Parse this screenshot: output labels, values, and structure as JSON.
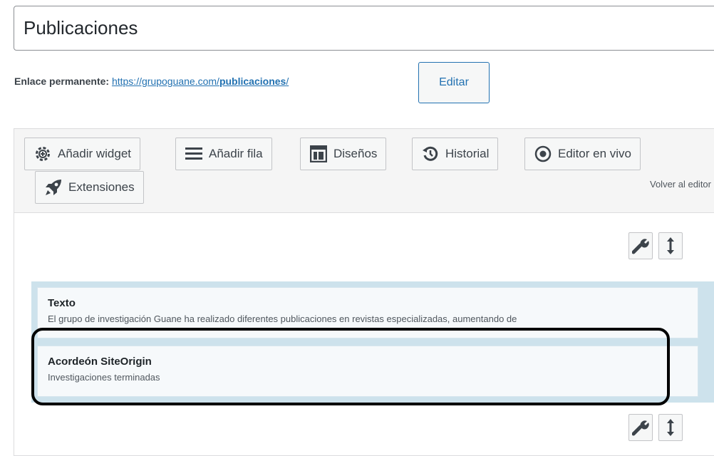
{
  "post": {
    "title": "Publicaciones",
    "permalink_label": "Enlace permanente:",
    "permalink_base": "https://grupoguane.com/",
    "permalink_slug": "publicaciones",
    "permalink_trail": "/",
    "edit_label": "Editar"
  },
  "builder": {
    "toolbar": {
      "add_widget": "Añadir widget",
      "add_row": "Añadir fila",
      "layouts": "Diseños",
      "history": "Historial",
      "live_editor": "Editor en vivo",
      "extensions": "Extensiones",
      "back_to_editor": "Volver al editor"
    },
    "widgets": [
      {
        "title": "Texto",
        "description": "El grupo de investigación Guane ha realizado diferentes publicaciones en revistas especializadas, aumentando de"
      },
      {
        "title": "Acordeón SiteOrigin",
        "description": "Investigaciones terminadas"
      }
    ]
  },
  "icons": {
    "add_widget": "gear-icon",
    "add_row": "hamburger-icon",
    "layouts": "layout-icon",
    "history": "history-icon",
    "live_editor": "eye-icon",
    "extensions": "rocket-icon",
    "row_settings": "wrench-icon",
    "row_move": "move-icon"
  },
  "colors": {
    "accent": "#2271b1",
    "cell_background": "#cde2ec",
    "highlight_border": "#000000"
  }
}
